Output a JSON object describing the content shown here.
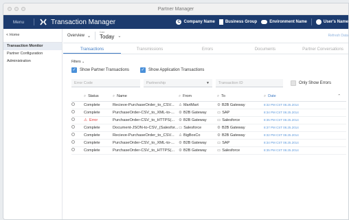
{
  "window": {
    "title": "Partner Manager"
  },
  "appbar": {
    "menu": "Menu",
    "title": "Transaction Manager",
    "company": "Company Name",
    "group": "Business Group",
    "environment": "Environment Name",
    "user": "User's Name"
  },
  "sidebar": {
    "home": "< Home",
    "items": [
      {
        "label": "Transaction Monitor",
        "active": true
      },
      {
        "label": "Partner Configuration",
        "active": false
      },
      {
        "label": "Administration",
        "active": false
      }
    ]
  },
  "topctl": {
    "overview": "Overview",
    "date_label": "Date",
    "date_value": "Today",
    "refresh": "Refresh Data"
  },
  "tabs": [
    "Transactions",
    "Transmissions",
    "Errors",
    "Documents",
    "Partner Conversations"
  ],
  "filters": {
    "label": "Filters",
    "show_partner": "Show Partner Transactions",
    "show_application": "Show Application Transactions",
    "error_code_placeholder": "Error Code",
    "partnership_placeholder": "Partnership",
    "transaction_id_placeholder": "Transaction ID",
    "only_errors": "Only Show Errors"
  },
  "table": {
    "headers": {
      "status": "Status",
      "name": "Name",
      "from": "From",
      "to": "To",
      "date": "Date"
    },
    "rows": [
      {
        "status": "Complete",
        "name": "Recieve-PurchaseOrder_to_CSV...",
        "from": "MartMart",
        "to": "B2B Gateway",
        "date": "8:32 PM CST 08.25.2014"
      },
      {
        "status": "Complete",
        "name": "PurchaseOrder-CSV_to_XML-to-...",
        "from": "B2B Gateway",
        "to": "SAP",
        "date": "8:34 PM CST 08.25.2014"
      },
      {
        "status": "Error",
        "name": "PurchaseOrder-CSV_to_HTTPS(...",
        "from": "B2B Gateway",
        "to": "Salesforce",
        "date": "8:35 PM CST 08.25.2014"
      },
      {
        "status": "Complete",
        "name": "Document-JSON-to-CSV_(Salesfor...",
        "from": "Salesforce",
        "to": "B2B Gateway",
        "date": "8:37 PM CST 08.25.2014"
      },
      {
        "status": "Complete",
        "name": "Recieve-PurchaseOrder_to_CSV...",
        "from": "BigBoxCo",
        "to": "B2B Gateway",
        "date": "8:32 PM CST 08.25.2014"
      },
      {
        "status": "Complete",
        "name": "PurchaseOrder-CSV_to_XML-to-...",
        "from": "B2B Gateway",
        "to": "SAP",
        "date": "8:34 PM CST 08.25.2014"
      },
      {
        "status": "Complete",
        "name": "PurchaseOrder-CSV_to_HTTPS(...",
        "from": "B2B Gateway",
        "to": "Salesforce",
        "date": "8:35 PM CST 08.25.2014"
      }
    ]
  },
  "colors": {
    "brand": "#1c3b6e",
    "accent": "#3f7bc4",
    "error": "#d33333"
  }
}
